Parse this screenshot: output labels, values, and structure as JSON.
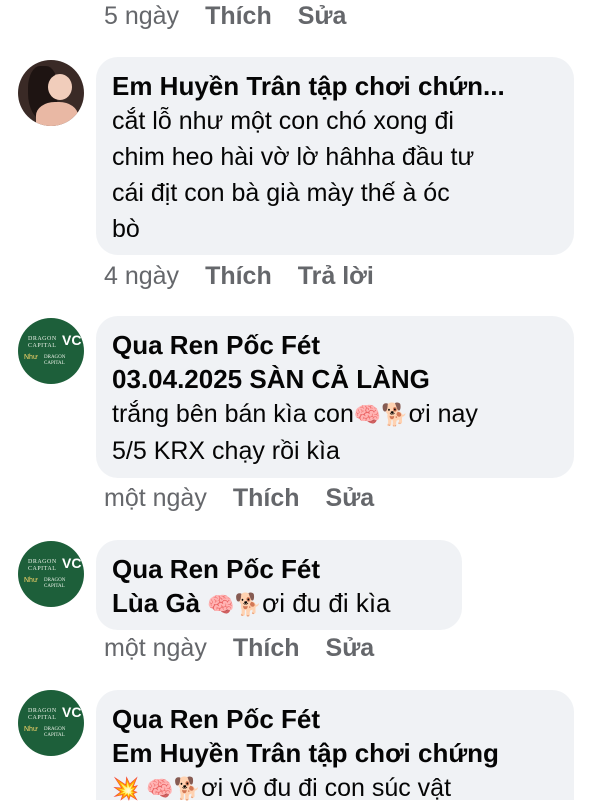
{
  "top_meta": {
    "time": "5 ngày",
    "like": "Thích",
    "action": "Sửa"
  },
  "comments": [
    {
      "author": "Em Huyền Trân tập chơi chứn...",
      "lines": [
        "cắt lỗ như một con chó xong đi",
        "chim heo hài vờ lờ hâhha đầu tư",
        "cái địt con bà già mày thế à óc",
        "bò"
      ],
      "time": "4 ngày",
      "like": "Thích",
      "action": "Trả lời",
      "avatar": "profile-photo"
    },
    {
      "author": "Qua Ren Pốc Fét",
      "headline": "03.04.2025 SÀN CẢ LÀNG",
      "line1_pre": "trắng bên bán kìa con",
      "line1_post": "ơi nay",
      "line2": "5/5 KRX chạy rồi kìa",
      "time": "một ngày",
      "like": "Thích",
      "action": "Sửa",
      "avatar": "dragon-capital-logo"
    },
    {
      "author": "Qua Ren Pốc Fét",
      "line_pre": "Lùa Gà ",
      "line_post": "ơi đu đi kìa",
      "time": "một ngày",
      "like": "Thích",
      "action": "Sửa",
      "avatar": "dragon-capital-logo"
    },
    {
      "author": "Qua Ren Pốc Fét",
      "headline": "Em Huyền Trân tập chơi chứng",
      "line_post": "ơi vô đu đi con súc vật",
      "avatar": "dragon-capital-logo"
    }
  ],
  "logo": {
    "line1": "DRAGON",
    "line2": "CAPITAL",
    "mark": "VC",
    "tag": "Như",
    "line3": "DRAGON",
    "line4": "CAPITAL"
  },
  "emojis": {
    "brain": "🧠",
    "dog": "🐕",
    "boom": "💥"
  },
  "colors": {
    "meta_text": "#65676b",
    "bubble": "#f0f2f5",
    "logo_bg": "#1d5f3a"
  }
}
